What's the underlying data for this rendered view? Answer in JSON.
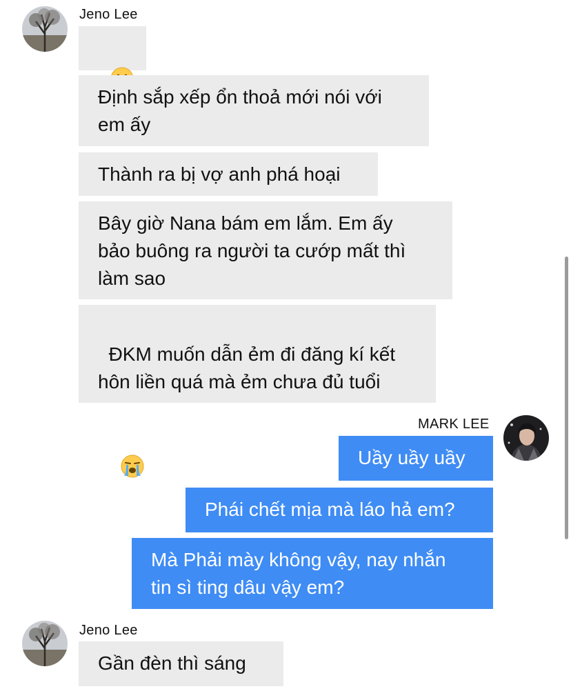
{
  "sender_in": "Jeno Lee",
  "sender_out": "MARK LEE",
  "messages": [
    {
      "text": "🙂"
    },
    {
      "text": "Định sắp xếp ổn thoả mới nói với\nem ấy"
    },
    {
      "text": "Thành ra bị vợ anh phá hoại"
    },
    {
      "text": "Bây giờ Nana bám em lắm. Em ấy\nbảo buông ra người ta cướp mất thì\nlàm sao"
    },
    {
      "text": "ĐKM muốn dẫn ẻm đi đăng kí kết\nhôn liền quá mà ẻm chưa đủ tuổi",
      "emoji": "😭"
    },
    {
      "text": "Uầy uầy uầy"
    },
    {
      "text": "Phái chết mịa mà láo hả em?"
    },
    {
      "text": "Mà Phải mày không vậy, nay nhắn\ntin sì ting dâu vậy em?"
    },
    {
      "text": "Gần đèn thì sáng"
    }
  ],
  "icons": {
    "avatar_in": "tree-avatar-photo",
    "avatar_out": "portrait-avatar-photo",
    "slight_smile": "slight-smile-emoji",
    "crying": "loudly-crying-emoji"
  },
  "colors": {
    "incoming_bubble": "#ebebeb",
    "outgoing_bubble": "#3f8cf4"
  }
}
